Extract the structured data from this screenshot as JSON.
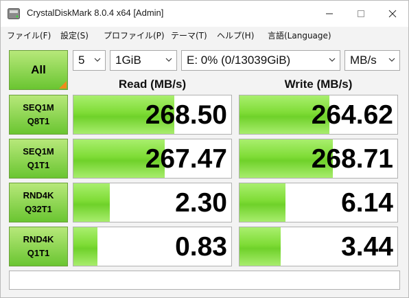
{
  "window": {
    "title": "CrystalDiskMark 8.0.4 x64 [Admin]"
  },
  "menu": [
    "ファイル(F)",
    "設定(S)",
    "プロファイル(P)",
    "テーマ(T)",
    "ヘルプ(H)",
    "言語(Language)"
  ],
  "controls": {
    "all_label": "All",
    "count": "5",
    "size": "1GiB",
    "drive": "E: 0% (0/13039GiB)",
    "unit": "MB/s"
  },
  "headers": {
    "read": "Read (MB/s)",
    "write": "Write (MB/s)"
  },
  "rows": [
    {
      "line1": "SEQ1M",
      "line2": "Q8T1",
      "read": "268.50",
      "write": "264.62",
      "read_frac": 0.64,
      "write_frac": 0.57
    },
    {
      "line1": "SEQ1M",
      "line2": "Q1T1",
      "read": "267.47",
      "write": "268.71",
      "read_frac": 0.58,
      "write_frac": 0.59
    },
    {
      "line1": "RND4K",
      "line2": "Q32T1",
      "read": "2.30",
      "write": "6.14",
      "read_frac": 0.23,
      "write_frac": 0.29
    },
    {
      "line1": "RND4K",
      "line2": "Q1T1",
      "read": "0.83",
      "write": "3.44",
      "read_frac": 0.15,
      "write_frac": 0.26
    }
  ],
  "status_text": ""
}
